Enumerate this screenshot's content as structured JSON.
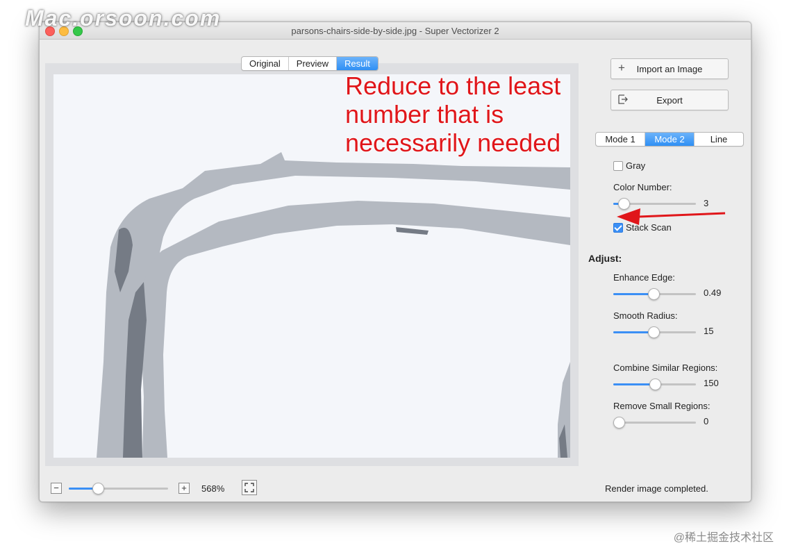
{
  "window": {
    "title": "parsons-chairs-side-by-side.jpg - Super Vectorizer 2"
  },
  "view_tabs": [
    {
      "label": "Original",
      "active": false
    },
    {
      "label": "Preview",
      "active": false
    },
    {
      "label": "Result",
      "active": true
    }
  ],
  "sidebar": {
    "import_label": "Import an Image",
    "import_icon": "plus-icon",
    "export_label": "Export",
    "export_icon": "export-icon",
    "mode_tabs": [
      {
        "label": "Mode 1",
        "active": false
      },
      {
        "label": "Mode 2",
        "active": true
      },
      {
        "label": "Line",
        "active": false
      }
    ],
    "gray": {
      "label": "Gray",
      "checked": false
    },
    "color_number": {
      "label": "Color Number:",
      "value": "3",
      "fraction": 0.07
    },
    "stack_scan": {
      "label": "Stack Scan",
      "checked": true
    },
    "adjust_heading": "Adjust:",
    "enhance_edge": {
      "label": "Enhance Edge:",
      "value": "0.49",
      "fraction": 0.49
    },
    "smooth_radius": {
      "label": "Smooth Radius:",
      "value": "15",
      "fraction": 0.49
    },
    "combine_similar": {
      "label": "Combine Similar Regions:",
      "value": "150",
      "fraction": 0.5
    },
    "remove_small": {
      "label": "Remove Small Regions:",
      "value": "0",
      "fraction": 0.0
    }
  },
  "bottom_bar": {
    "zoom_out_icon": "minus-icon",
    "zoom_in_icon": "plus-icon",
    "zoom_level": "568%",
    "zoom_fraction": 0.27,
    "fit_icon": "fit-to-window-icon",
    "status": "Render image completed."
  },
  "annotation": "Reduce to the least number that is necessarily needed",
  "watermark": "Mac.orsoon.com",
  "credit": "@稀土掘金技术社区",
  "colors": {
    "accent": "#3a8ff5",
    "annotation_red": "#e0161a",
    "shape_light": "#b4b9c1",
    "shape_dark": "#757b85",
    "canvas_bg": "#f4f6fa"
  }
}
